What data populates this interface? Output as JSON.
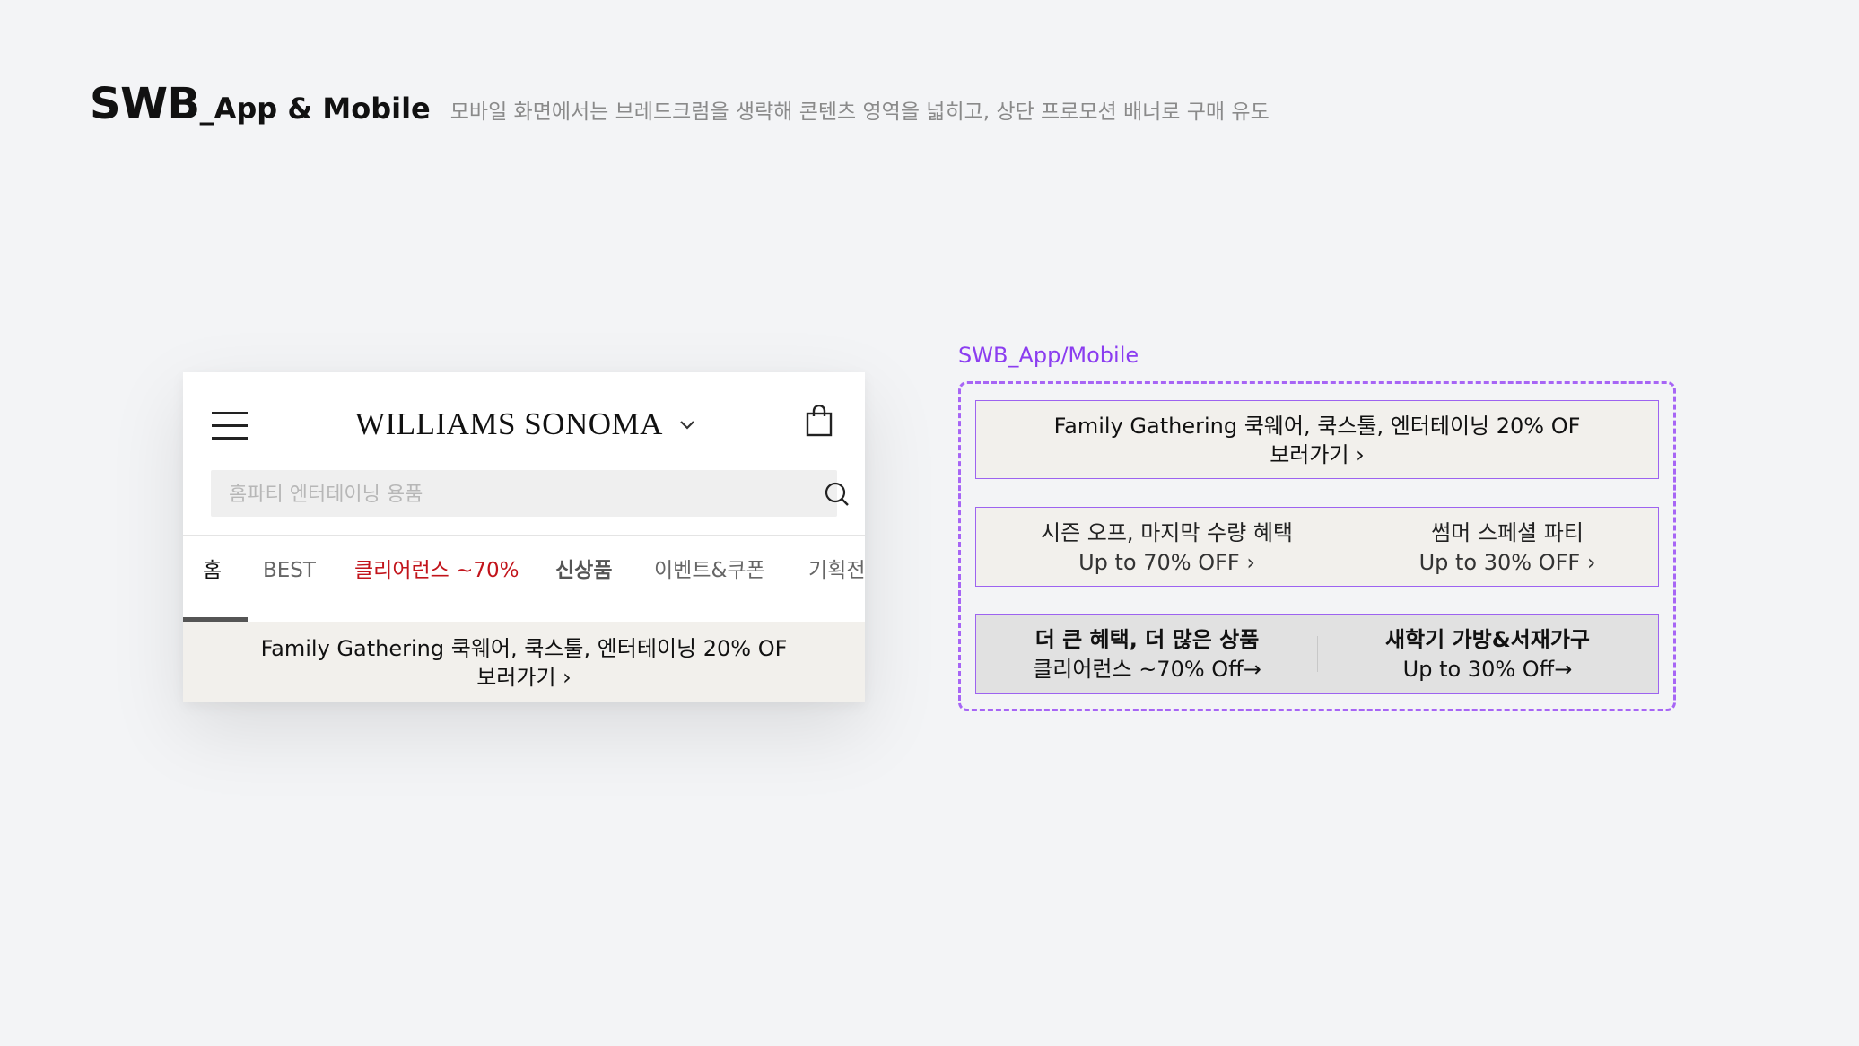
{
  "page": {
    "title": "SWB",
    "title_sub": "_App & Mobile",
    "description": "모바일 화면에서는 브레드크럼을 생략해 콘텐츠 영역을 넓히고, 상단 프로모션 배너로 구매 유도"
  },
  "phone": {
    "brand": "WILLIAMS SONOMA",
    "search_placeholder": "홈파티 엔터테이닝 용품",
    "tabs": [
      {
        "label": "홈"
      },
      {
        "label": "BEST"
      },
      {
        "label": "클리어런스 ~70%"
      },
      {
        "label": "신상품"
      },
      {
        "label": "이벤트&쿠폰"
      },
      {
        "label": "기획전"
      }
    ],
    "promo": {
      "line1": "Family Gathering 쿡웨어, 쿡스툴, 엔터테이닝 20% OF",
      "line2": "보러가기 ›"
    }
  },
  "spec": {
    "label": "SWB_App/Mobile",
    "banner1": {
      "line1": "Family Gathering 쿡웨어, 쿡스툴, 엔터테이닝 20% OF",
      "line2": "보러가기 ›"
    },
    "banner2": {
      "left": {
        "title": "시즌 오프, 마지막 수량 혜택",
        "sub": "Up to 70% OFF ›"
      },
      "right": {
        "title": "썸머 스페셜 파티",
        "sub": "Up to 30% OFF ›"
      }
    },
    "banner3": {
      "left": {
        "title": "더 큰 혜택, 더 많은 상품",
        "sub": "클리어런스 ~70% Off→"
      },
      "right": {
        "title": "새학기 가방&서재가구",
        "sub": "Up to 30% Off→"
      }
    }
  },
  "colors": {
    "background": "#f3f4f6",
    "accent_purple": "#8b3df0",
    "sale_red": "#c2141b",
    "promo_bg": "#f2f0ec"
  },
  "icons": [
    "hamburger-menu-icon",
    "chevron-down-icon",
    "shopping-bag-icon",
    "search-icon"
  ]
}
